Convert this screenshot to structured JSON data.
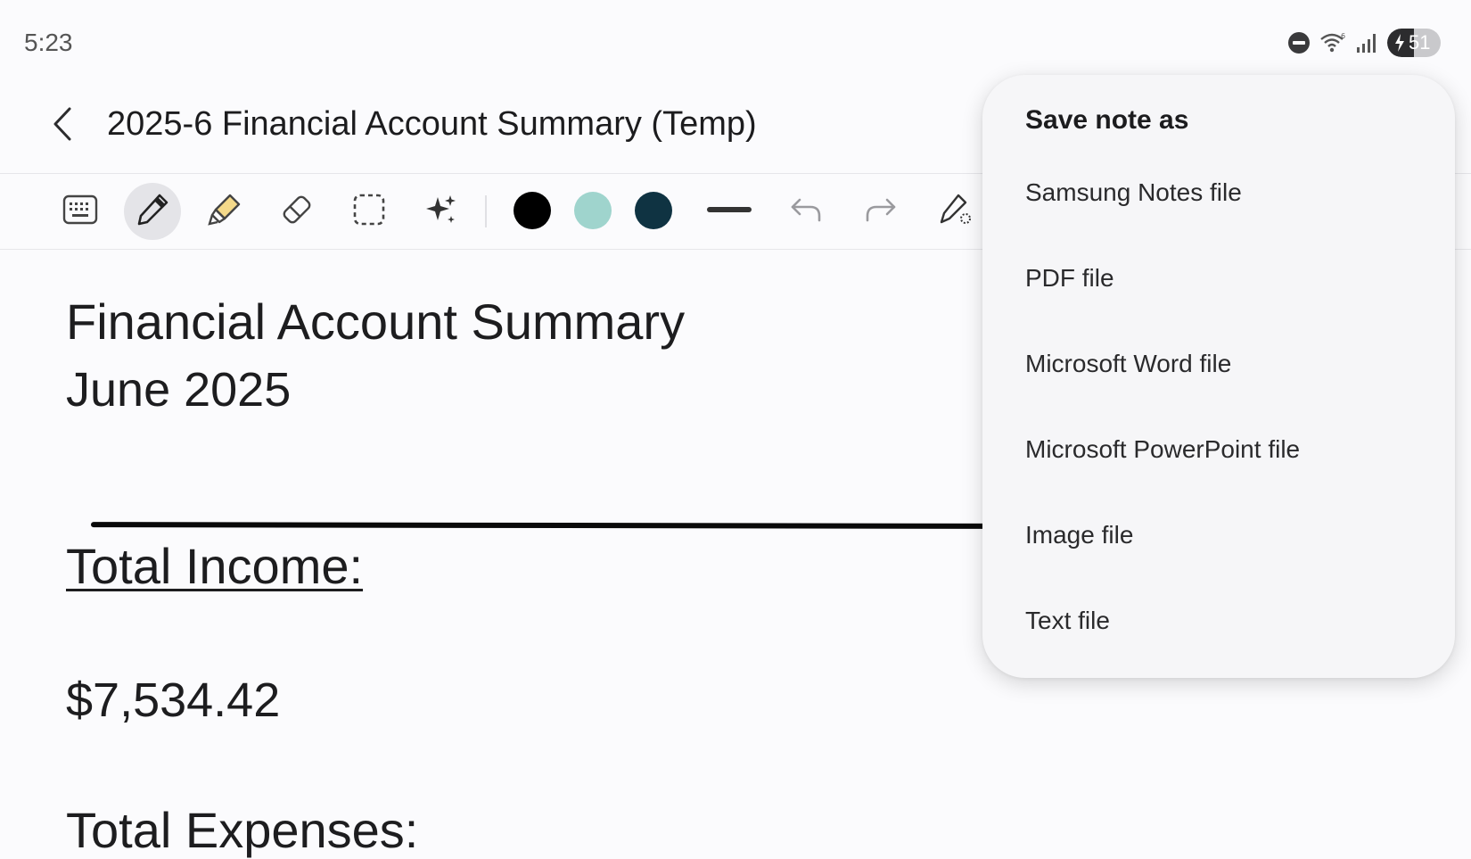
{
  "status_bar": {
    "time": "5:23",
    "battery_level": "51",
    "battery_fill_fraction": 0.5,
    "icons": [
      "do-not-disturb-icon",
      "wifi-icon",
      "signal-icon",
      "battery-charging-icon"
    ]
  },
  "header": {
    "title": "2025-6 Financial Account Summary (Temp)",
    "back_icon": "back-arrow-icon"
  },
  "toolbar": {
    "tools": [
      "keyboard-icon",
      "pen-icon",
      "highlighter-icon",
      "eraser-icon",
      "selection-icon",
      "ai-sparkle-icon"
    ],
    "active_tool": "pen-icon",
    "colors": [
      "#000000",
      "#9fd4cd",
      "#0f3342"
    ],
    "actions": [
      "stroke-width-icon",
      "undo-icon",
      "redo-icon",
      "pen-settings-icon"
    ]
  },
  "document": {
    "heading": "Financial Account Summary",
    "subheading": "June 2025",
    "income_label": "Total Income:",
    "income_value": "$7,534.42",
    "expenses_label": "Total Expenses:"
  },
  "menu": {
    "title": "Save note as",
    "items": [
      "Samsung Notes file",
      "PDF file",
      "Microsoft Word file",
      "Microsoft PowerPoint file",
      "Image file",
      "Text file"
    ]
  }
}
